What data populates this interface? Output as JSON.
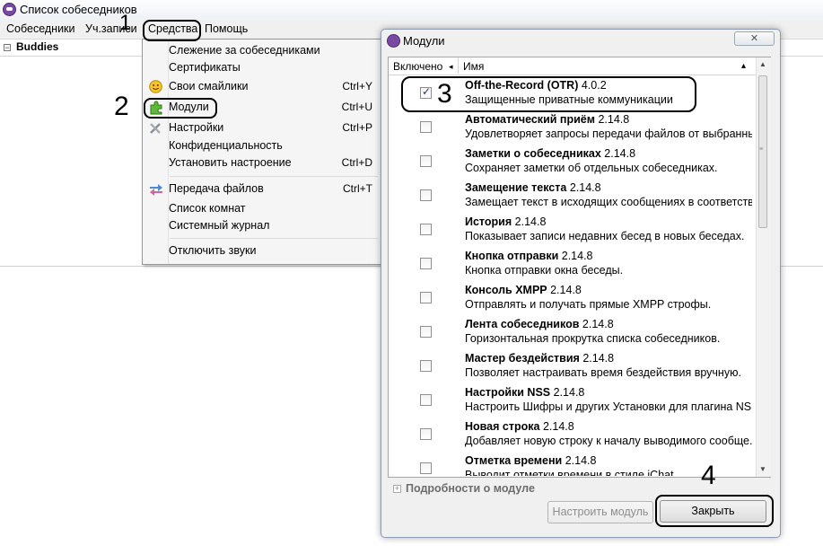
{
  "window": {
    "title": "Список собеседников"
  },
  "menubar": [
    "Собеседники",
    "Уч.записи",
    "Средства",
    "Помощь"
  ],
  "buddies": {
    "label": "Buddies",
    "toggle": "−"
  },
  "tools_menu": {
    "items": [
      {
        "label": "Слежение за собеседниками",
        "shortcut": ""
      },
      {
        "label": "Сертификаты",
        "shortcut": ""
      },
      {
        "label": "Свои смайлики",
        "shortcut": "Ctrl+Y",
        "icon": "smiley-icon"
      },
      {
        "label": "Модули",
        "shortcut": "Ctrl+U",
        "icon": "puzzle-icon"
      },
      {
        "label": "Настройки",
        "shortcut": "Ctrl+P",
        "icon": "tools-icon"
      },
      {
        "label": "Конфиденциальность",
        "shortcut": ""
      },
      {
        "label": "Установить настроение",
        "shortcut": "Ctrl+D"
      },
      {
        "label": "Передача файлов",
        "shortcut": "Ctrl+T",
        "icon": "file-transfer-icon"
      },
      {
        "label": "Список комнат",
        "shortcut": ""
      },
      {
        "label": "Системный журнал",
        "shortcut": ""
      },
      {
        "label": "Отключить звуки",
        "shortcut": ""
      }
    ]
  },
  "modules_dialog": {
    "title": "Модули",
    "close_glyph": "✕",
    "columns": {
      "enabled": "Включено",
      "name": "Имя",
      "sort_left": "◂",
      "sort_up": "▴"
    },
    "plugins": [
      {
        "name": "Off-the-Record (OTR)",
        "version": "4.0.2",
        "description": "Защищенные приватные коммуникации",
        "enabled": true
      },
      {
        "name": "Автоматический приём",
        "version": "2.14.8",
        "description": "Удовлетворяет запросы передачи файлов от выбранны...",
        "enabled": false
      },
      {
        "name": "Заметки о собеседниках",
        "version": "2.14.8",
        "description": "Сохраняет заметки об отдельных собеседниках.",
        "enabled": false
      },
      {
        "name": "Замещение текста",
        "version": "2.14.8",
        "description": "Замещает текст в исходящих сообщениях в соответстви...",
        "enabled": false
      },
      {
        "name": "История",
        "version": "2.14.8",
        "description": "Показывает записи недавних бесед в новых беседах.",
        "enabled": false
      },
      {
        "name": "Кнопка отправки",
        "version": "2.14.8",
        "description": "Кнопка отправки окна беседы.",
        "enabled": false
      },
      {
        "name": "Консоль XMPP",
        "version": "2.14.8",
        "description": "Отправлять и получать прямые XMPP строфы.",
        "enabled": false
      },
      {
        "name": "Лента собеседников",
        "version": "2.14.8",
        "description": "Горизонтальная прокрутка списка собеседников.",
        "enabled": false
      },
      {
        "name": "Мастер бездействия",
        "version": "2.14.8",
        "description": "Позволяет настраивать время бездействия вручную.",
        "enabled": false
      },
      {
        "name": "Настройки NSS",
        "version": "2.14.8",
        "description": "Настроить Шифры и других Установки для плагина NSS...",
        "enabled": false
      },
      {
        "name": "Новая строка",
        "version": "2.14.8",
        "description": "Добавляет новую строку к началу выводимого сообще...",
        "enabled": false
      },
      {
        "name": "Отметка времени",
        "version": "2.14.8",
        "description": "Выводит отметки времени в стиле iChat",
        "enabled": false
      }
    ],
    "details": {
      "toggle": "+",
      "label": "Подробности о модуле"
    },
    "configure_button": "Настроить модуль",
    "close_button": "Закрыть"
  },
  "step_markers": [
    "1",
    "2",
    "3",
    "4"
  ]
}
